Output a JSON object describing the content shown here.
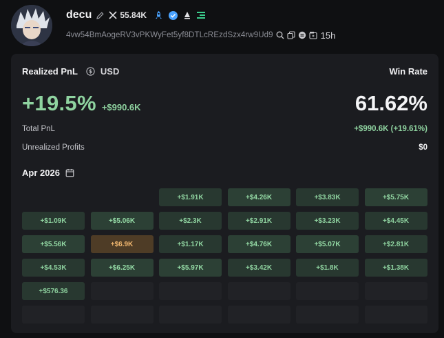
{
  "profile": {
    "name": "decu",
    "followers": "55.84K",
    "address": "4vw54BmAogeRV3vPKWyFet5yf8DTLcREzdSzx4rw9Ud9",
    "age": "15h",
    "icons": [
      "edit-icon",
      "x-logo-icon",
      "rocket-icon",
      "verified-badge-icon",
      "user-icon",
      "menu-lines-icon",
      "search-icon",
      "copy-icon",
      "coin-icon",
      "wallet-age-icon"
    ]
  },
  "card": {
    "realized_label": "Realized PnL",
    "currency_label": "USD",
    "winrate_label": "Win Rate",
    "pnl_percent": "+19.5%",
    "pnl_usd": "+$990.6K",
    "win_rate": "61.62%",
    "total_pnl_label": "Total PnL",
    "total_pnl_value": "+$990.6K (+19.61%)",
    "unrealized_label": "Unrealized Profits",
    "unrealized_value": "$0",
    "month_label": "Apr 2026"
  },
  "calendar": [
    [
      "",
      "",
      "+$1.91K",
      "+$4.26K",
      "+$3.83K",
      "+$5.75K"
    ],
    [
      "+$1.09K",
      "+$5.06K",
      "+$2.3K",
      "+$2.91K",
      "+$3.23K",
      "+$4.45K"
    ],
    [
      "+$5.56K",
      "+$6.9K",
      "+$1.17K",
      "+$4.76K",
      "+$5.07K",
      "+$2.81K"
    ],
    [
      "+$4.53K",
      "+$6.25K",
      "+$5.97K",
      "+$3.42K",
      "+$1.8K",
      "+$1.38K"
    ],
    [
      "+$576.36",
      "",
      "",
      "",
      "",
      ""
    ],
    [
      "",
      "",
      "",
      "",
      "",
      ""
    ]
  ],
  "colors": {
    "positive": "#8fd3a0",
    "best_day": "#f2b870",
    "accent_blue": "#4aa3ff",
    "accent_green": "#3ccf8e"
  }
}
